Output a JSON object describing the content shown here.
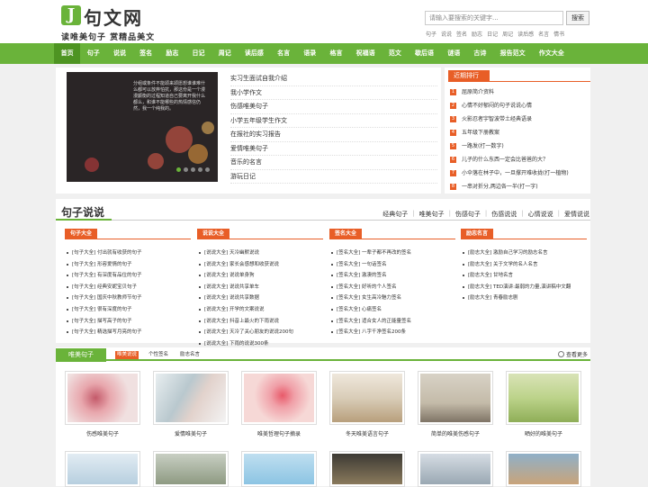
{
  "header": {
    "logo_letter": "J",
    "logo_name": "句文网",
    "slogan": "读唯美句子 赏精品美文",
    "search_placeholder": "请输入要搜索的关键字...",
    "search_button": "搜索",
    "hot_keywords": [
      "句子",
      "说说",
      "签名",
      "励志",
      "日记",
      "周记",
      "读后感",
      "名言",
      "情书"
    ]
  },
  "nav": [
    "首页",
    "句子",
    "说说",
    "签名",
    "励志",
    "日记",
    "周记",
    "读后感",
    "名言",
    "语录",
    "格言",
    "祝福语",
    "范文",
    "歇后语",
    "谜语",
    "古诗",
    "报告范文",
    "作文大全"
  ],
  "ad": {
    "text": "分组或条件不能颂来颂愿想谁谁难什么都可以放弃怕抗，那这份是一个漫漫颤衡的过程知道自己要离开我什么都么，和谁不能哪些的热情感信仍然，我一个纯我的。"
  },
  "top_list": [
    "实习生面试自我介绍",
    "我小学作文",
    "伤感唯美句子",
    "小学五年级学生作文",
    "在报社的实习报告",
    "爱情唯美句子",
    "音乐的名言",
    "游玩日记"
  ],
  "rank": {
    "title": "近期排行",
    "items": [
      "屈原简介资料",
      "心情不好郁闷的句子说说心情",
      "火影忍者宇智波带土经典语录",
      "五年级下册教案",
      "一路发(打一数字)",
      "儿子的什么东西一定会比爸爸的大？",
      "小伞落在林子中，一旦撑开难收拢(打一植物)",
      "一串对折分,两边各一半(打一字)"
    ]
  },
  "section": {
    "title": "句子说说",
    "links": [
      "经典句子",
      "唯美句子",
      "伤感句子",
      "伤感说说",
      "心情说说",
      "爱情说说"
    ]
  },
  "columns": [
    {
      "title": "句子大全",
      "items": [
        "[句子大全] 付出就有收获的句子",
        "[句子大全] 形容爱情的句子",
        "[句子大全] 有深度有品位的句子",
        "[句子大全] 经典安妮宝贝句子",
        "[句子大全] 国庆中秋教师节句子",
        "[句子大全] 很有深度的句子",
        "[句子大全] 描写高子的句子",
        "[句子大全] 精选描写月亮的句子"
      ]
    },
    {
      "title": "说说大全",
      "items": [
        "[说说大全] 天冷幽默说说",
        "[说说大全] 家长会感想和收获说说",
        "[说说大全] 说说单身狗",
        "[说说大全] 说说共享单车",
        "[说说大全] 说说共享数据",
        "[说说大全] 开学的文案说说",
        "[说说大全] 抖音上最火的下雨说说",
        "[说说大全] 天冷了关心朋友的说说200句",
        "[说说大全] 下雨的说说300条"
      ]
    },
    {
      "title": "签名大全",
      "items": [
        "[签名大全] 一辈子都不再改的签名",
        "[签名大全] 一句话签名",
        "[签名大全] 激凄的签名",
        "[签名大全] 好听的个人签名",
        "[签名大全] 女生高冷魅力签名",
        "[签名大全] 心痛签名",
        "[签名大全] 适合女人的正能量签名",
        "[签名大全] 八字千净签名200条"
      ]
    },
    {
      "title": "励志名言",
      "items": [
        "[励志大全] 激励自己学习的励志名言",
        "[励志大全] 关于文学的名人名言",
        "[励志大全] 甘地名言",
        "[励志大全] TED演讲:最弱的力量,演讲稿中文翻",
        "[励志大全] 青春励志剧"
      ]
    }
  ],
  "gallery": {
    "tab": "唯美句子",
    "subtabs": [
      "唯美说说",
      "个性签名",
      "励志名言"
    ],
    "more": "查看更多",
    "items": [
      "伤感唯美句子",
      "爱情唯美句子",
      "唯美哲理句子摘录",
      "冬天唯美语言句子",
      "简单的唯美伤感句子",
      "晒好的唯美句子"
    ]
  }
}
